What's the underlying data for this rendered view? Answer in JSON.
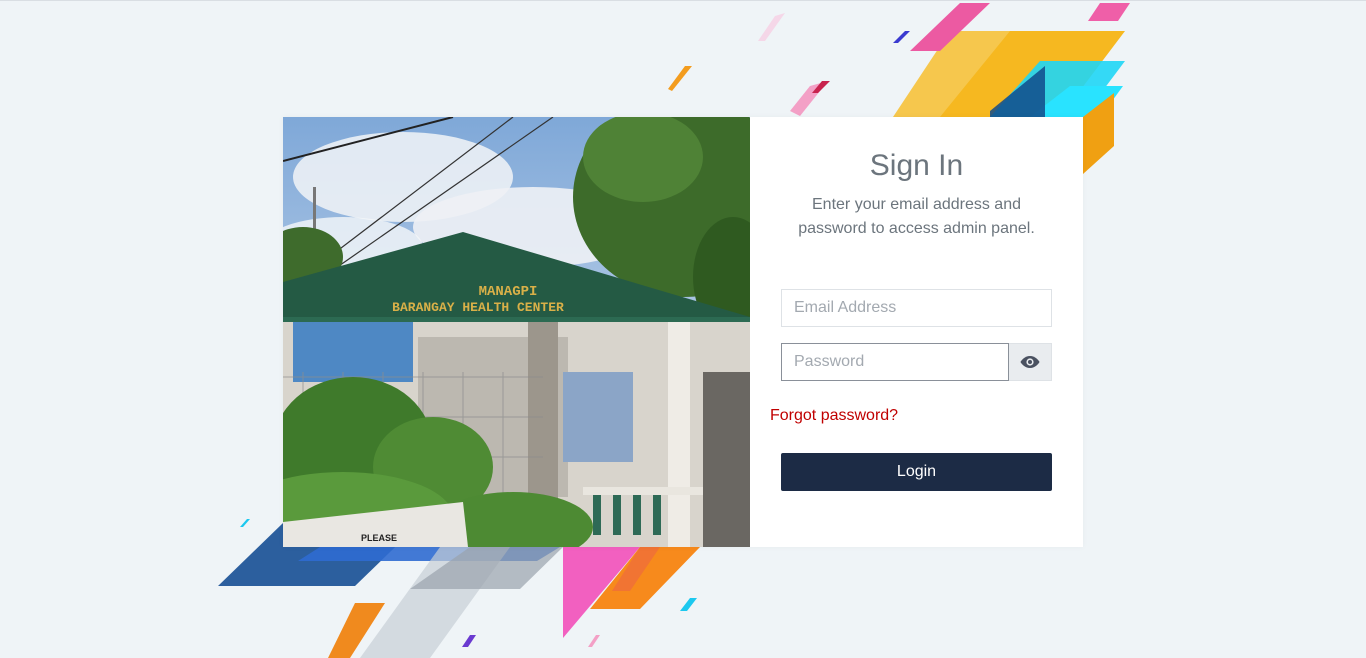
{
  "signin": {
    "title": "Sign In",
    "subtitle": "Enter your email address and password to access admin panel.",
    "email_placeholder": "Email Address",
    "password_placeholder": "Password",
    "forgot_label": "Forgot password?",
    "login_label": "Login"
  },
  "photo": {
    "sign_line1": "MANAGPI",
    "sign_line2": "BARANGAY HEALTH CENTER",
    "notice_line1": "PLEASE"
  },
  "colors": {
    "login_button": "#1c2b45",
    "forgot_link": "#c00000",
    "background": "#eff4f7"
  }
}
